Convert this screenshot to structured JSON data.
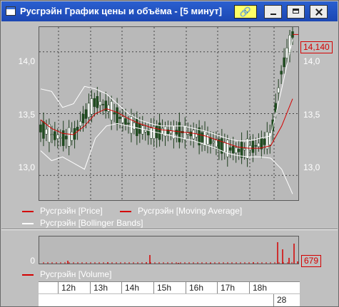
{
  "window": {
    "title": "Русгрэйн График цены и объёма - [5 минут]",
    "link_icon": "chain-link-icon",
    "buttons": [
      "minimize-icon",
      "maximize-icon",
      "close-icon"
    ]
  },
  "price_chart": {
    "y_labels": [
      "14,0",
      "13,5",
      "13,0"
    ],
    "last_price": "14,140",
    "colors": {
      "price": "#d40000",
      "moving_average": "#d40000",
      "bollinger": "#ffffff",
      "candle_up": "#ffffff",
      "candle_down": "#1f4d1f"
    }
  },
  "legend": {
    "price": "Русгрэйн [Price]",
    "moving_average": "Русгрэйн [Moving Average]",
    "bollinger": "Русгрэйн [Bollinger Bands]",
    "volume": "Русгрэйн [Volume]"
  },
  "volume_chart": {
    "y_label": "0",
    "last_volume": "679"
  },
  "time_axis": {
    "hours": [
      "12h",
      "13h",
      "14h",
      "15h",
      "16h",
      "17h",
      "18h"
    ],
    "day": "28"
  },
  "chart_data": {
    "type": "line",
    "ylim": [
      12.8,
      14.2
    ],
    "y_ticks": [
      13.0,
      13.5,
      14.0
    ],
    "grid": true,
    "legend_position": "bottom",
    "series": [
      {
        "name": "Русгрэйн [Price]",
        "values": [
          13.38,
          13.33,
          13.3,
          13.32,
          13.48,
          13.6,
          13.56,
          13.48,
          13.42,
          13.38,
          13.34,
          13.36,
          13.35,
          13.35,
          13.33,
          13.3,
          13.26,
          13.22,
          13.2,
          13.22,
          13.25,
          13.3,
          13.85,
          14.14
        ]
      },
      {
        "name": "Русгрэйн [Moving Average]",
        "values": [
          13.45,
          13.38,
          13.34,
          13.33,
          13.4,
          13.5,
          13.54,
          13.51,
          13.46,
          13.42,
          13.39,
          13.37,
          13.36,
          13.35,
          13.34,
          13.32,
          13.29,
          13.26,
          13.23,
          13.22,
          13.22,
          13.24,
          13.4,
          13.62
        ]
      },
      {
        "name": "Русгрэйн [Bollinger Bands]",
        "values": [
          13.7,
          13.68,
          13.55,
          13.58,
          13.72,
          13.7,
          13.66,
          13.58,
          13.5,
          13.45,
          13.42,
          13.4,
          13.4,
          13.4,
          13.38,
          13.36,
          13.33,
          13.3,
          13.28,
          13.28,
          13.3,
          13.32,
          13.7,
          14.1
        ]
      },
      {
        "name": "Русгрэйн [Bollinger Bands]",
        "values": [
          13.2,
          13.12,
          13.15,
          13.1,
          13.05,
          13.3,
          13.4,
          13.42,
          13.4,
          13.38,
          13.36,
          13.34,
          13.32,
          13.3,
          13.28,
          13.25,
          13.22,
          13.18,
          13.16,
          13.15,
          13.15,
          13.14,
          13.05,
          12.85
        ]
      }
    ],
    "volume": {
      "name": "Русгрэйн [Volume]",
      "last": 679
    }
  }
}
